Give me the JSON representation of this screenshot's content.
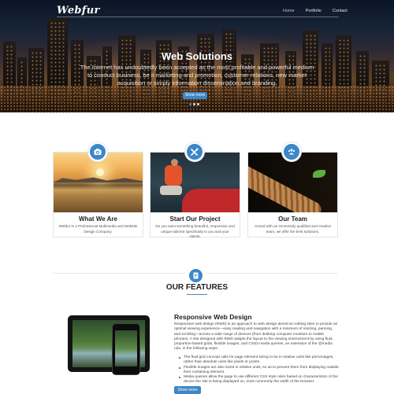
{
  "brand": {
    "logo": "Webfur"
  },
  "nav": {
    "items": [
      "Home",
      "Portfolio",
      "Contact"
    ],
    "active": "Home"
  },
  "hero": {
    "title": "Web Solutions",
    "text": "The Internet has undoubtedly been accepted as the most profitable and powerful medium to conduct business, be it marketing and promotion, customer relations, new market acquisition or simply information dissemination and branding.",
    "button": "Show more",
    "slides": 3,
    "active_slide": 1
  },
  "cards": [
    {
      "icon": "camera-icon",
      "title": "What We Are",
      "text": "Webfur is a Professional Multimedia and Website Design Company."
    },
    {
      "icon": "tools-icon",
      "title": "Start Our Project",
      "text": "Do you want something beautiful, responsive and unique tailored specifically to you and your clients."
    },
    {
      "icon": "team-icon",
      "title": "Our Team",
      "text": "Armed with an immensely qualified and creative team, we offer the best solutions."
    }
  ],
  "features": {
    "icon": "document-icon",
    "title": "OUR FEATURES",
    "item": {
      "title": "Responsive Web Design",
      "text": "Responsive web design (RWD) is an approach to web design aimed at crafting sites to provide an optimal viewing experience—easy reading and navigation with a minimum of resizing, panning, and scrolling—across a wide range of devices (from desktop computer monitors to mobile phones). A site designed with RWD adapts the layout to the viewing environment by using fluid, proportion-based grids, flexible images, and CSS3 media queries, an extension of the @media rule, in the following ways:",
      "bullets": [
        "The fluid grid concept calls for page element sizing to be in relative units like percentages, rather than absolute units like pixels or points.",
        "Flexible images are also sized in relative units, so as to prevent them from displaying outside their containing element.",
        "Media queries allow the page to use different CSS style rules based on characteristics of the device the site is being displayed on, most commonly the width of the browser."
      ],
      "button": "Show more"
    }
  },
  "colors": {
    "accent": "#3d87c9"
  }
}
